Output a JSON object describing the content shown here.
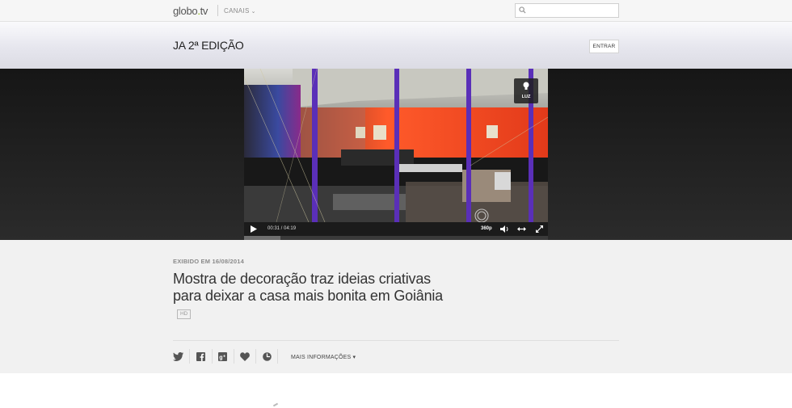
{
  "nav": {
    "logo_main": "globo",
    "logo_dot": ".",
    "logo_tv": "tv",
    "channels_label": "CANAIS",
    "search_placeholder": "",
    "search_icon": "search-icon"
  },
  "header": {
    "program_title": "JA 2ª EDIÇÃO",
    "login_label": "ENTRAR"
  },
  "player": {
    "luz_label": "LUZ",
    "time": "00:31 / 04:19",
    "quality": "360p",
    "progress": 0.12,
    "icons": [
      "play-icon",
      "volume-icon",
      "widen-icon",
      "fullscreen-icon",
      "bulb-icon"
    ]
  },
  "video": {
    "aired": "EXIBIDO EM 16/08/2014",
    "title": "Mostra de decoração traz ideias criativas para deixar a casa mais bonita em Goiânia",
    "hd_badge": "HD",
    "more_info": "MAIS INFORMAÇÕES"
  },
  "social": [
    "twitter-icon",
    "facebook-icon",
    "google-plus-icon",
    "heart-icon",
    "clock-icon"
  ],
  "colors": {
    "accent_green": "#84b400",
    "stage_bg": "#1f1f1f",
    "info_bg": "#f1f1f1"
  }
}
